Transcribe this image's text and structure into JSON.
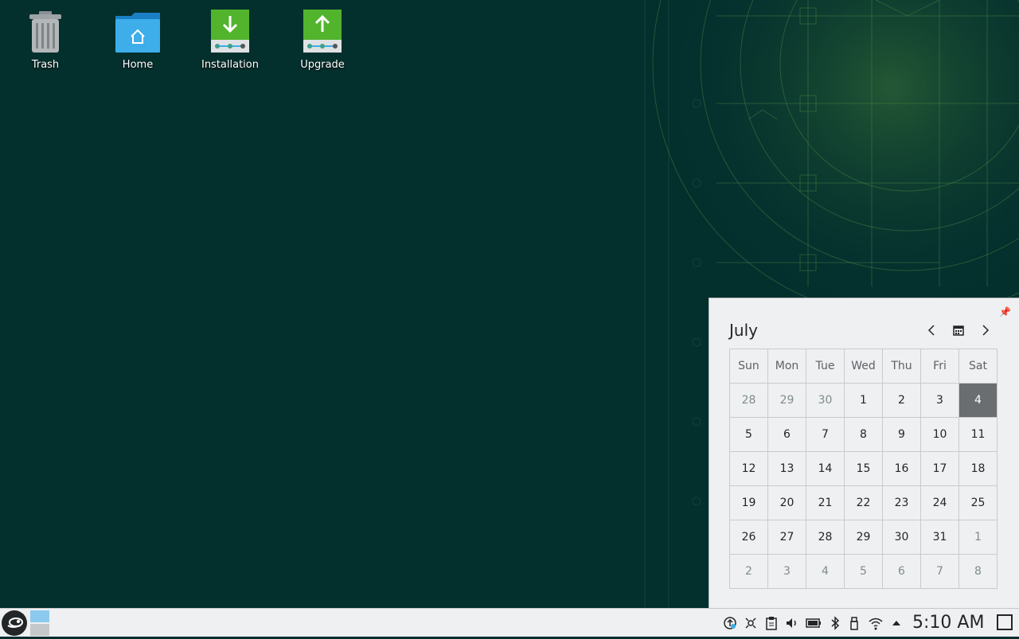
{
  "desktop": {
    "icons": [
      {
        "label": "Trash"
      },
      {
        "label": "Home"
      },
      {
        "label": "Installation"
      },
      {
        "label": "Upgrade"
      }
    ]
  },
  "calendar": {
    "month": "July",
    "weekdays": [
      "Sun",
      "Mon",
      "Tue",
      "Wed",
      "Thu",
      "Fri",
      "Sat"
    ],
    "weeks": [
      [
        "28",
        "29",
        "30",
        "1",
        "2",
        "3",
        "4"
      ],
      [
        "5",
        "6",
        "7",
        "8",
        "9",
        "10",
        "11"
      ],
      [
        "12",
        "13",
        "14",
        "15",
        "16",
        "17",
        "18"
      ],
      [
        "19",
        "20",
        "21",
        "22",
        "23",
        "24",
        "25"
      ],
      [
        "26",
        "27",
        "28",
        "29",
        "30",
        "31",
        "1"
      ],
      [
        "2",
        "3",
        "4",
        "5",
        "6",
        "7",
        "8"
      ]
    ],
    "today": "4"
  },
  "taskbar": {
    "clock": "5:10 AM",
    "tray_icons": [
      "updates-icon",
      "network-config-icon",
      "clipboard-icon",
      "volume-icon",
      "battery-icon",
      "bluetooth-icon",
      "usb-device-icon",
      "wifi-icon",
      "expand-tray-icon"
    ]
  },
  "colors": {
    "wallpaper": "#032f2d",
    "accent": "#3daee9",
    "today_highlight": "#6b6e70"
  }
}
